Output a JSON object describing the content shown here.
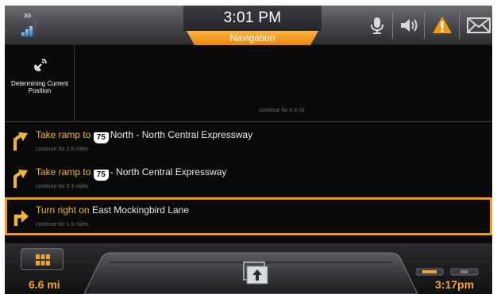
{
  "status_bar": {
    "network": "3G",
    "time": "3:01 PM",
    "mode": "Navigation",
    "icons": [
      "signal-icon",
      "microphone-icon",
      "speaker-icon",
      "warning-icon",
      "mail-icon"
    ],
    "accent_color": "#f39a15"
  },
  "position_panel": {
    "text": "Determining Current Position",
    "continue_text": "continue for 0.4 mi"
  },
  "directions": [
    {
      "action": "Take ramp to",
      "shield": "75",
      "road": "North - North Central Expressway",
      "continue_text": "continue for 2.6 miles",
      "icon": "bear-right-icon"
    },
    {
      "action": "Take ramp to",
      "shield": "75",
      "road": "- North Central Expressway",
      "continue_text": "continue for 0.3 miles",
      "icon": "bear-right-icon"
    },
    {
      "action": "Turn right on",
      "road": "East Mockingbird Lane",
      "continue_text": "continue for 1.5 miles",
      "icon": "turn-right-icon",
      "selected": true
    }
  ],
  "dock": {
    "distance": "6.6 mi",
    "arrival_time": "3:17pm"
  }
}
